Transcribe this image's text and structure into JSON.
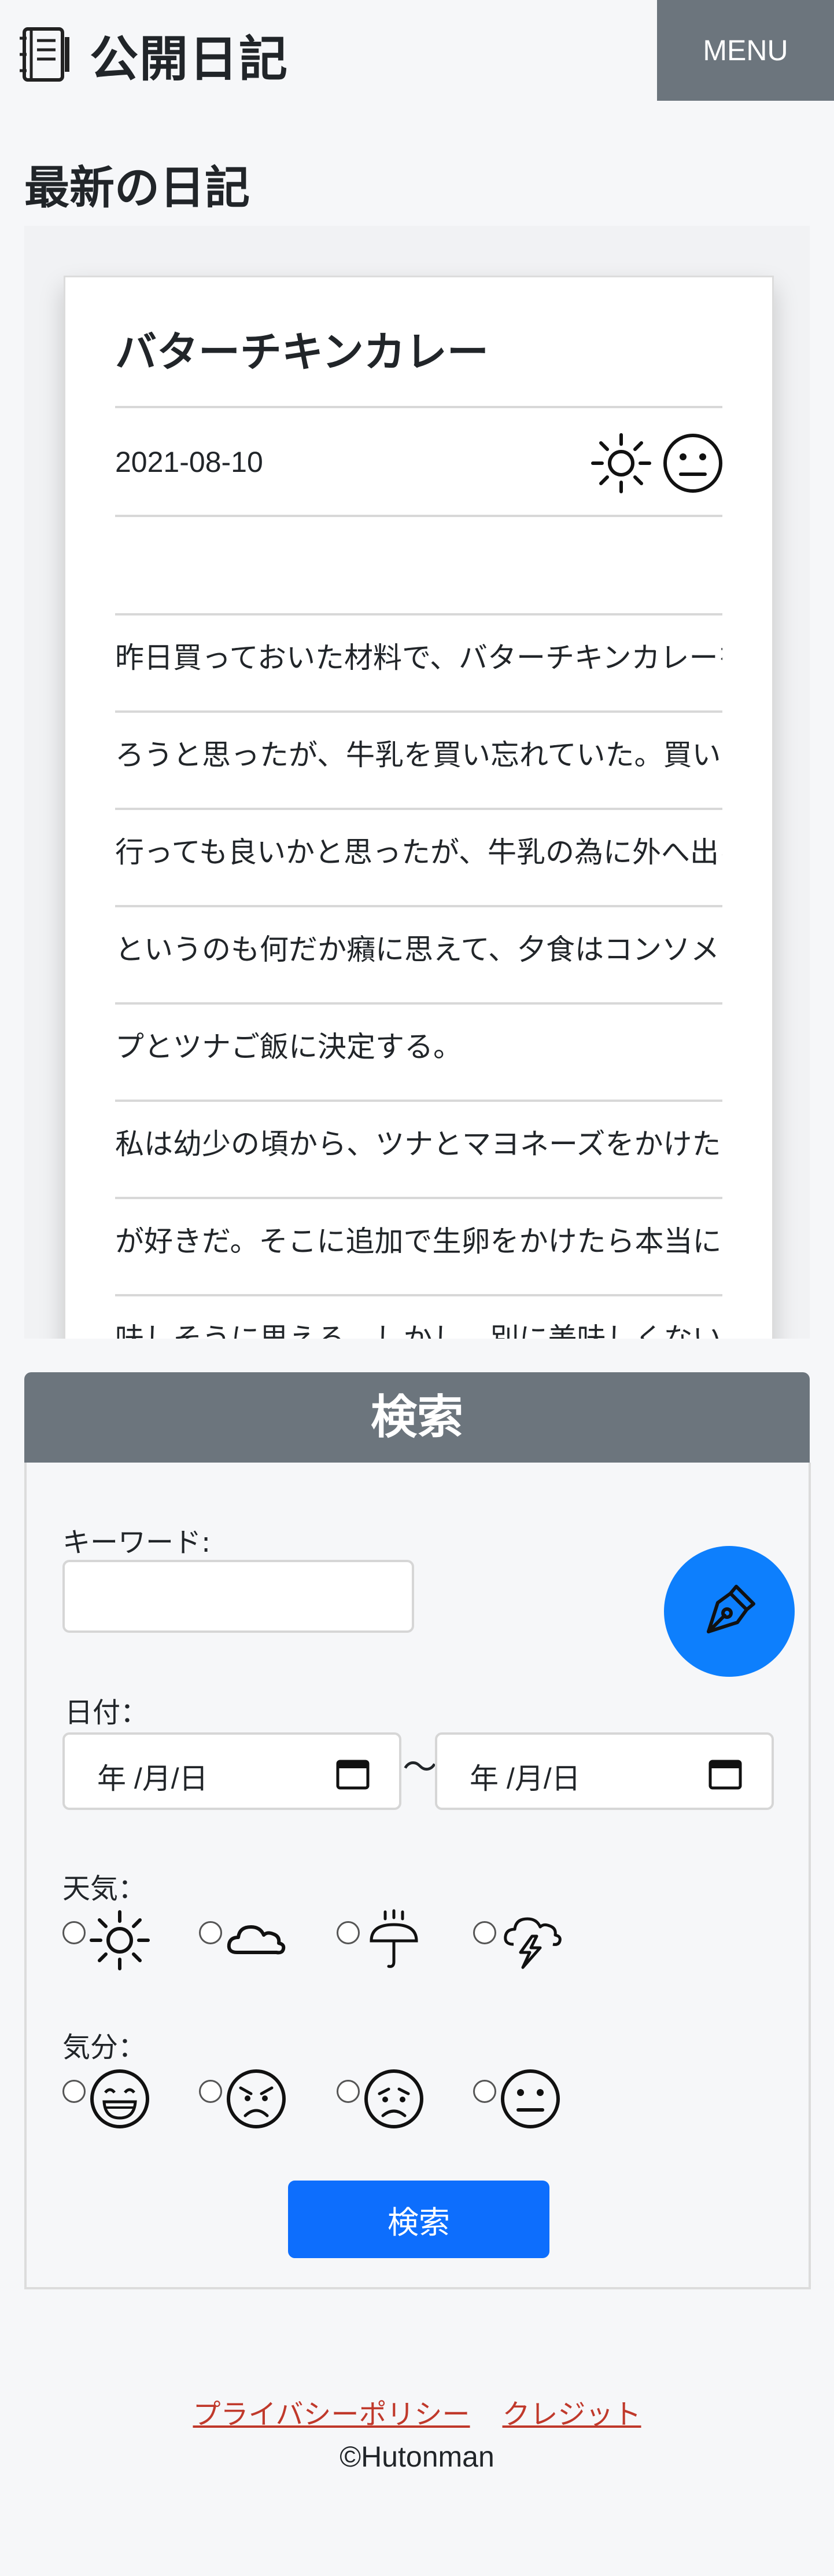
{
  "header": {
    "site_title": "公開日記",
    "menu_label": "MENU"
  },
  "latest": {
    "section_title": "最新の日記",
    "entry": {
      "title": "バターチキンカレー",
      "date": "2021-08-10",
      "weather_icon": "sun-icon",
      "mood_icon": "neutral-face-icon",
      "lines": [
        "昨日買っておいた材料で、バターチキンカレーを作",
        "ろうと思ったが、牛乳を買い忘れていた。買いに",
        "行っても良いかと思ったが、牛乳の為に外へ出る",
        "というのも何だか癪に思えて、夕食はコンソメスー",
        "プとツナご飯に決定する。",
        "私は幼少の頃から、ツナとマヨネーズをかけたご飯",
        "が好きだ。そこに追加で生卵をかけたら本当に美",
        "味しそうに思える。しかし、別に美味しくない。你"
      ]
    }
  },
  "search": {
    "title": "検索",
    "keyword_label": "キーワード:",
    "keyword_value": "",
    "date_label": "日付：",
    "date_from_placeholder": "年 /月/日",
    "date_separator": "〜",
    "date_to_placeholder": "年 /月/日",
    "weather_label": "天気：",
    "weather_options": [
      "sun-icon",
      "cloud-icon",
      "umbrella-rain-icon",
      "thunder-cloud-icon"
    ],
    "mood_label": "気分：",
    "mood_options": [
      "grinning-face-icon",
      "angry-face-icon",
      "sad-face-icon",
      "neutral-face-icon"
    ],
    "submit_label": "検索",
    "write_button_icon": "pen-icon"
  },
  "footer": {
    "privacy_label": "プライバシーポリシー",
    "credit_label": "クレジット",
    "copyright": "©Hutonman"
  },
  "colors": {
    "menu_bg": "#6c757d",
    "primary": "#0d6efd",
    "fab": "#0d7ffd",
    "link": "#c0392b",
    "page_bg": "#f6f7f9"
  }
}
